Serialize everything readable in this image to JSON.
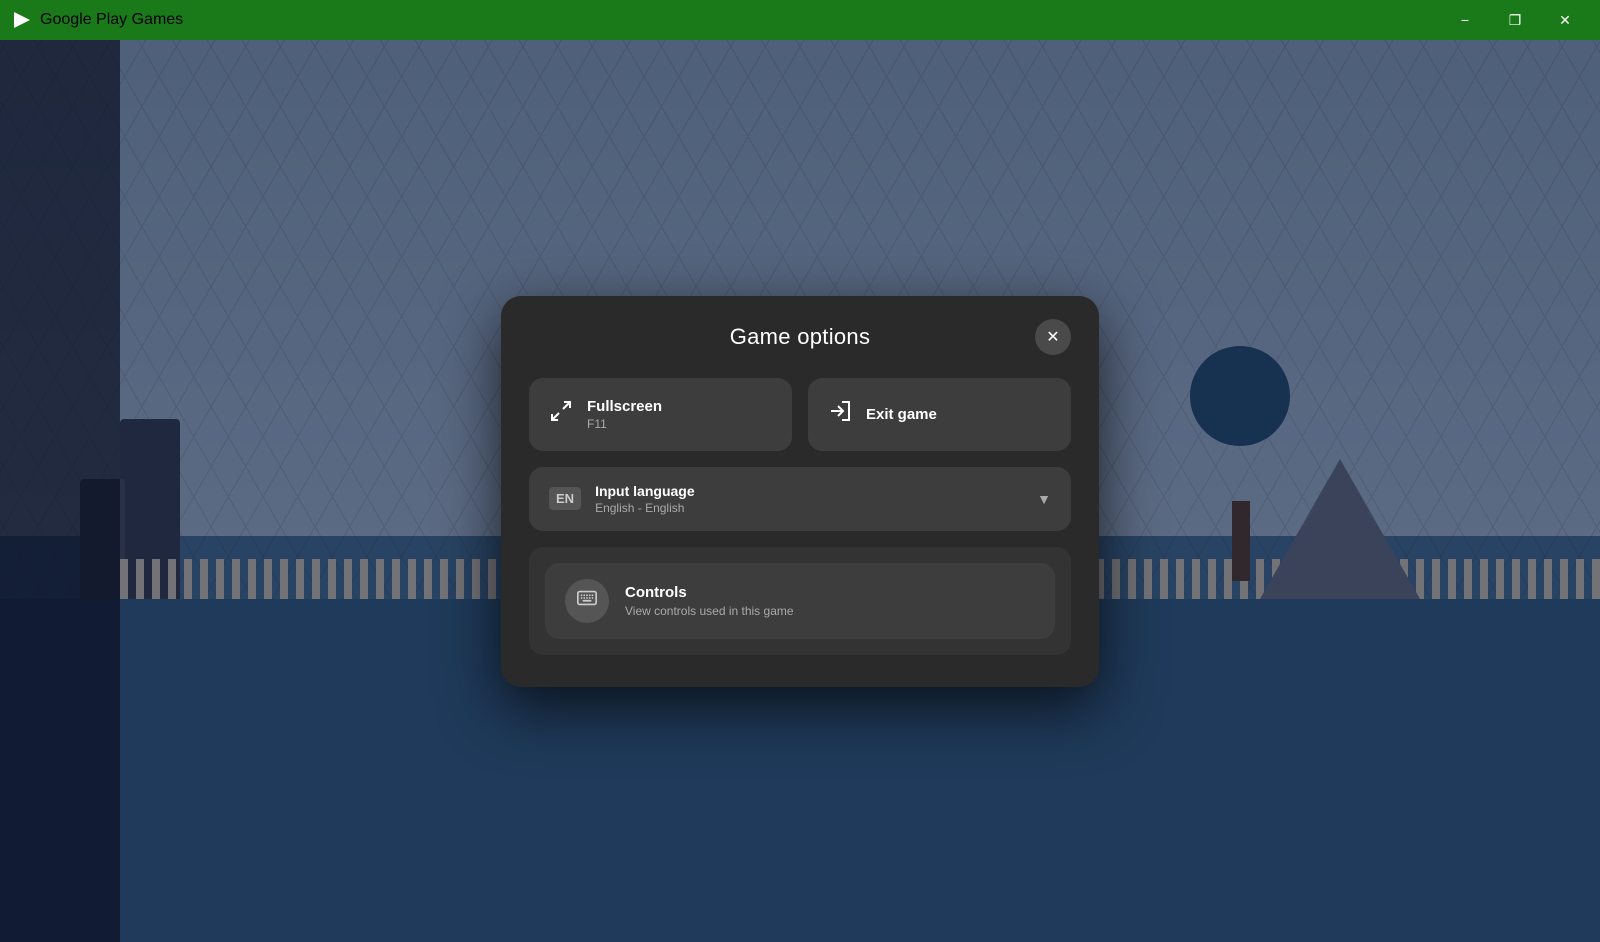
{
  "titlebar": {
    "app_name": "Google Play Games",
    "minimize_label": "−",
    "maximize_label": "❐",
    "close_label": "✕"
  },
  "modal": {
    "title": "Game options",
    "close_label": "✕",
    "fullscreen_label": "Fullscreen",
    "fullscreen_shortcut": "F11",
    "exit_label": "Exit game",
    "language_section_label": "Input language",
    "language_value": "English - English",
    "language_code": "EN",
    "controls_label": "Controls",
    "controls_sublabel": "View controls used in this game"
  },
  "colors": {
    "titlebar_green": "#1e7e1e",
    "modal_bg": "#2a2a2a",
    "button_bg": "#3d3d3d",
    "section_bg": "#333333"
  }
}
